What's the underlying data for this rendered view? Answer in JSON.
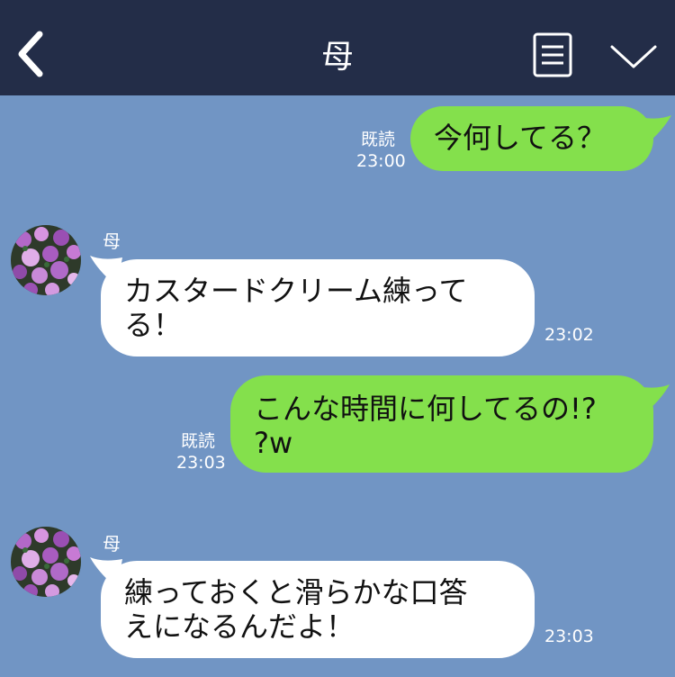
{
  "header": {
    "title": "母",
    "back_icon": "chevron-left-icon",
    "menu_icon": "list-icon",
    "dropdown_icon": "chevron-down-icon",
    "background": "#232d48"
  },
  "chat": {
    "background": "#7195c4",
    "outgoing_color": "#84e04c",
    "incoming_color": "#ffffff",
    "messages": [
      {
        "direction": "out",
        "text": "今何してる？",
        "read": "既読",
        "time": "23:00"
      },
      {
        "direction": "in",
        "sender": "母",
        "line1": "カスタードクリーム練って",
        "line2": "る！",
        "time": "23:02"
      },
      {
        "direction": "out",
        "line1": "こんな時間に何してるの!?",
        "line2": "?w",
        "read": "既読",
        "time": "23:03"
      },
      {
        "direction": "in",
        "sender": "母",
        "line1": "練っておくと滑らかな口答",
        "line2": "えになるんだよ！",
        "time": "23:03"
      }
    ]
  }
}
